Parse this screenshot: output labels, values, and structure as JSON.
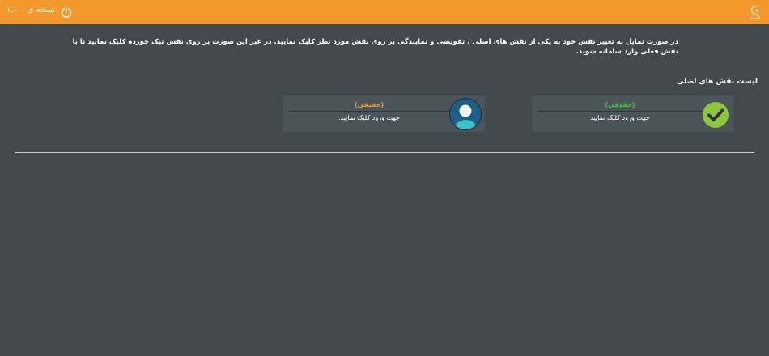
{
  "header": {
    "version": "نسخه ی ۱.۰.۰",
    "icons": {
      "power": "power-icon",
      "logo": "logo-icon"
    },
    "colors": {
      "bar": "#f3982a"
    }
  },
  "notice": "در صورت تمایل به تغییر نقش خود به یکی از نقش های اصلی ، تفویضی و نمایندگی بر روی نقش مورد نظر کلیک نمایید. در غیر این صورت بر روی نقش تیک خورده کلیک نمایید تا با نقش فعلی وارد سامانه شوید.",
  "roles": {
    "title": "لیست نقش های اصلی",
    "items": [
      {
        "type": "(حقوقی)",
        "action": "جهت ورود کلیک نمایید",
        "icon": "check-icon",
        "type_color": "#37c837"
      },
      {
        "type": "(حقیقی)",
        "action": "جهت ورود کلیک نمایید.",
        "icon": "avatar-icon",
        "type_color": "#f3982a"
      }
    ]
  }
}
